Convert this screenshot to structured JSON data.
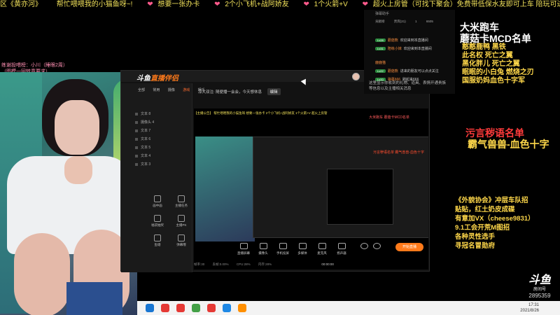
{
  "marquee": {
    "segments": [
      "区《黄亦河》",
      "帮忙喂喂我的小猫鱼呀~!",
      "想要一张办卡",
      "2个小飞机+战阿娇友",
      "1个火箭+V",
      "超火上房管（可找下聚会）免费带低保水友即可上车 陪玩可进组"
    ]
  },
  "left_notes": {
    "line1": "练谢投喂榜：小川（睡眼2周）",
    "line2": "（图模一回转意要求）"
  },
  "app": {
    "logo_text": "斗鱼",
    "logo_o": "直播伴侣",
    "tabs": [
      "全部",
      "常用",
      "摄像",
      "游戏",
      "娱乐"
    ],
    "active_tab": "游戏",
    "scenes": [
      "文本 8",
      "摄像头 4",
      "文本 7",
      "文本 6",
      "文本 5",
      "文本 4",
      "文本 3"
    ],
    "notice": "凉大双注: 随便播一会会，今天想休息",
    "notice_button": "编辑",
    "tools": [
      {
        "label": "画中画"
      },
      {
        "label": "主播任务"
      },
      {
        "label": "福袋抽奖"
      },
      {
        "label": "主播PK"
      },
      {
        "label": "鱼塘"
      },
      {
        "label": "弹幕哦"
      }
    ],
    "bottom_items": [
      "直播屏幕",
      "摄像头",
      "手机投屏",
      "多媒体",
      "麦克风",
      "扬声器"
    ],
    "start_button": "开始直播",
    "status": [
      "帧率:30",
      "丢帧:0.00%",
      "CPU:28%",
      "内存:28%",
      "00:00:00"
    ]
  },
  "preview": {
    "scroll": "【主播公告】 帮忙喂喂我的小猫鱼呀 想要一张办卡 2个小飞机+战阿娇友 1个火箭+V 超火上房管",
    "inner_text": "大米跑车 蘑菇卡MCD名单",
    "inner_tag": "污言秽语名单 霸气兽兽-血色十字"
  },
  "chat": {
    "header": "弹幕助手",
    "stats": [
      "贡献榜",
      "贵宾(21)",
      "1",
      "6505"
    ],
    "subtabs": [
      "贡献榜",
      "贵宾(21)"
    ],
    "messages": [
      {
        "badge": "Lv28",
        "nick": "蘑菇熊",
        "text": "欢迎来到本直播间"
      },
      {
        "badge": "Lv31",
        "nick": "陪练小妹",
        "text": "欢迎来到本直播间"
      },
      {
        "badge": "",
        "nick": "鹿鹿猫",
        "text": ""
      },
      {
        "badge": "Lv22",
        "nick": "蘑菇熊",
        "text": "进来的朋友可以点点关注"
      },
      {
        "badge": "Lv20",
        "nick": "弹幕666",
        "text": "刷起来666"
      }
    ],
    "hint": "这里显示你收到的礼物、道具、表情开通贵族等信息以及主播相关消息"
  },
  "overlay": {
    "title_line1": "大米跑车",
    "title_line2": "蘑菇卡MCD名单",
    "names": [
      "憨憨鹿鸭 黑铁",
      "此名权 死亡之翼",
      "黑化胖儿 死亡之翼",
      "眠眠的小白兔 燃烧之刃",
      "国服奶妈血色十字军"
    ],
    "title2": "污言秽语名单",
    "title2_sub": "霸气兽兽-血色十字",
    "rules": [
      "《外貌协会》冲层车队招",
      "贴贴，红土奶皮成碟",
      "有意加VX（cheese9831）",
      "9.1工会开荒M图招",
      "各种灵性选手",
      "寻冠名冒勋府"
    ]
  },
  "douyu": {
    "logo": "斗鱼",
    "sub": "房间号",
    "room_id": "2895359"
  },
  "taskbar": {
    "time": "17:31",
    "date": "2021/8/26"
  },
  "colors": {
    "accent": "#ff7a1a",
    "overlay_yellow": "#ffd84a",
    "overlay_red": "#ff3b3b"
  }
}
